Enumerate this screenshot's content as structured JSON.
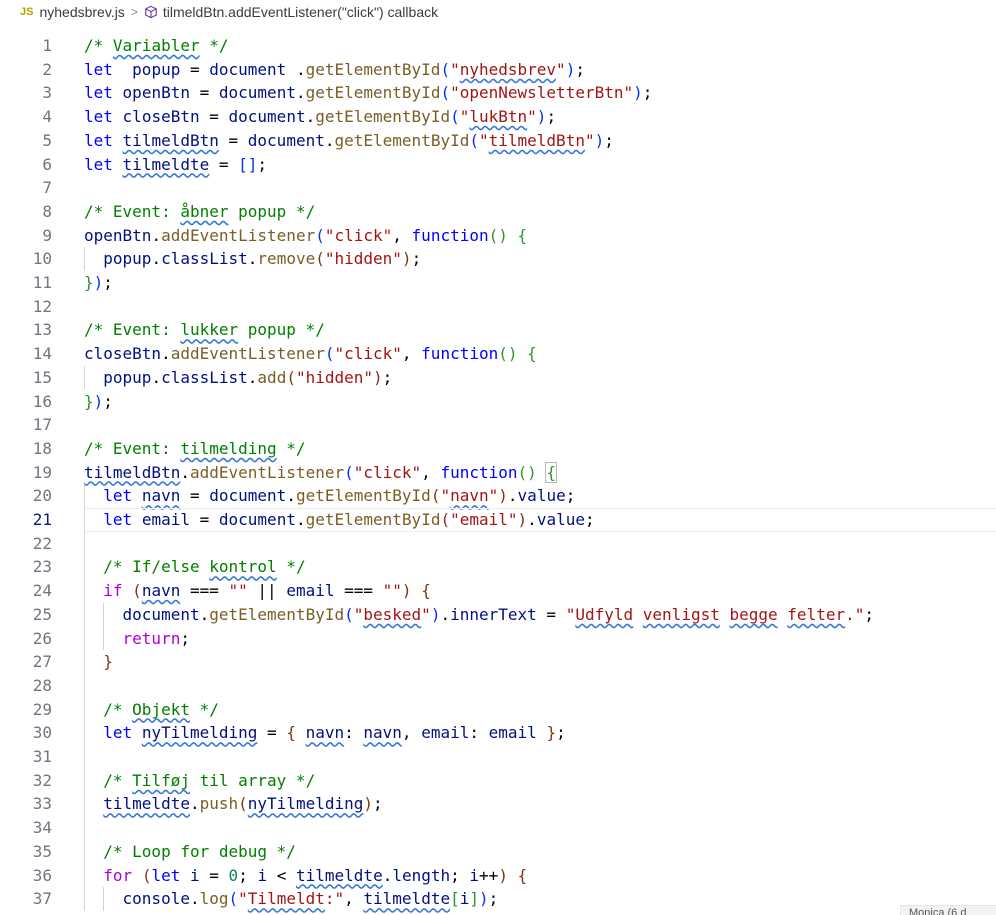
{
  "breadcrumb": {
    "lang_badge": "JS",
    "file": "nyhedsbrev.js",
    "separator": ">",
    "symbol": "tilmeldBtn.addEventListener(\"click\") callback"
  },
  "editor": {
    "current_line": 21,
    "lines": [
      {
        "n": "1",
        "tokens": [
          [
            "cm",
            "/* "
          ],
          [
            "cm sq",
            "Variabler"
          ],
          [
            "cm",
            " */"
          ]
        ]
      },
      {
        "n": "2",
        "tokens": [
          [
            "kw",
            "let"
          ],
          [
            "",
            "  "
          ],
          [
            "var",
            "popup"
          ],
          [
            "",
            " = "
          ],
          [
            "var",
            "document"
          ],
          [
            "",
            " ."
          ],
          [
            "fn",
            "getElementById"
          ],
          [
            "br1",
            "("
          ],
          [
            "str",
            "\""
          ],
          [
            "str sq",
            "nyhedsbrev"
          ],
          [
            "str",
            "\""
          ],
          [
            "br1",
            ")"
          ],
          [
            "",
            ";"
          ]
        ]
      },
      {
        "n": "3",
        "tokens": [
          [
            "kw",
            "let"
          ],
          [
            "",
            " "
          ],
          [
            "var",
            "openBtn"
          ],
          [
            "",
            " = "
          ],
          [
            "var",
            "document"
          ],
          [
            "",
            "."
          ],
          [
            "fn",
            "getElementById"
          ],
          [
            "br1",
            "("
          ],
          [
            "str",
            "\"openNewsletterBtn\""
          ],
          [
            "br1",
            ")"
          ],
          [
            "",
            ";"
          ]
        ]
      },
      {
        "n": "4",
        "tokens": [
          [
            "kw",
            "let"
          ],
          [
            "",
            " "
          ],
          [
            "var",
            "closeBtn"
          ],
          [
            "",
            " = "
          ],
          [
            "var",
            "document"
          ],
          [
            "",
            "."
          ],
          [
            "fn",
            "getElementById"
          ],
          [
            "br1",
            "("
          ],
          [
            "str",
            "\""
          ],
          [
            "str sq",
            "lukBtn"
          ],
          [
            "str",
            "\""
          ],
          [
            "br1",
            ")"
          ],
          [
            "",
            ";"
          ]
        ]
      },
      {
        "n": "5",
        "tokens": [
          [
            "kw",
            "let"
          ],
          [
            "",
            " "
          ],
          [
            "var sq",
            "tilmeldBtn"
          ],
          [
            "",
            " = "
          ],
          [
            "var",
            "document"
          ],
          [
            "",
            "."
          ],
          [
            "fn",
            "getElementById"
          ],
          [
            "br1",
            "("
          ],
          [
            "str",
            "\""
          ],
          [
            "str sq",
            "tilmeldBtn"
          ],
          [
            "str",
            "\""
          ],
          [
            "br1",
            ")"
          ],
          [
            "",
            ";"
          ]
        ]
      },
      {
        "n": "6",
        "tokens": [
          [
            "kw",
            "let"
          ],
          [
            "",
            " "
          ],
          [
            "var sq",
            "tilmeldte"
          ],
          [
            "",
            " = "
          ],
          [
            "br1",
            "[]"
          ],
          [
            "",
            ";"
          ]
        ]
      },
      {
        "n": "7",
        "tokens": []
      },
      {
        "n": "8",
        "tokens": [
          [
            "cm",
            "/* Event: "
          ],
          [
            "cm sq",
            "åbner"
          ],
          [
            "cm",
            " popup */"
          ]
        ]
      },
      {
        "n": "9",
        "tokens": [
          [
            "var",
            "openBtn"
          ],
          [
            "",
            "."
          ],
          [
            "fn",
            "addEventListener"
          ],
          [
            "br1",
            "("
          ],
          [
            "str",
            "\"click\""
          ],
          [
            "",
            ", "
          ],
          [
            "kw",
            "function"
          ],
          [
            "br2",
            "()"
          ],
          [
            "",
            " "
          ],
          [
            "br2",
            "{"
          ]
        ]
      },
      {
        "n": "10",
        "tokens": [
          [
            "",
            "  "
          ],
          [
            "var",
            "popup"
          ],
          [
            "",
            "."
          ],
          [
            "var",
            "classList"
          ],
          [
            "",
            "."
          ],
          [
            "fn",
            "remove"
          ],
          [
            "br3",
            "("
          ],
          [
            "str",
            "\"hidden\""
          ],
          [
            "br3",
            ")"
          ],
          [
            "",
            ";"
          ]
        ]
      },
      {
        "n": "11",
        "tokens": [
          [
            "br2",
            "}"
          ],
          [
            "br1",
            ")"
          ],
          [
            "",
            ";"
          ]
        ]
      },
      {
        "n": "12",
        "tokens": []
      },
      {
        "n": "13",
        "tokens": [
          [
            "cm",
            "/* Event: "
          ],
          [
            "cm sq",
            "lukker"
          ],
          [
            "cm",
            " popup */"
          ]
        ]
      },
      {
        "n": "14",
        "tokens": [
          [
            "var",
            "closeBtn"
          ],
          [
            "",
            "."
          ],
          [
            "fn",
            "addEventListener"
          ],
          [
            "br1",
            "("
          ],
          [
            "str",
            "\"click\""
          ],
          [
            "",
            ", "
          ],
          [
            "kw",
            "function"
          ],
          [
            "br2",
            "()"
          ],
          [
            "",
            " "
          ],
          [
            "br2",
            "{"
          ]
        ]
      },
      {
        "n": "15",
        "tokens": [
          [
            "",
            "  "
          ],
          [
            "var",
            "popup"
          ],
          [
            "",
            "."
          ],
          [
            "var",
            "classList"
          ],
          [
            "",
            "."
          ],
          [
            "fn",
            "add"
          ],
          [
            "br3",
            "("
          ],
          [
            "str",
            "\"hidden\""
          ],
          [
            "br3",
            ")"
          ],
          [
            "",
            ";"
          ]
        ]
      },
      {
        "n": "16",
        "tokens": [
          [
            "br2",
            "}"
          ],
          [
            "br1",
            ")"
          ],
          [
            "",
            ";"
          ]
        ]
      },
      {
        "n": "17",
        "tokens": []
      },
      {
        "n": "18",
        "tokens": [
          [
            "cm",
            "/* Event: "
          ],
          [
            "cm sq",
            "tilmelding"
          ],
          [
            "cm",
            " */"
          ]
        ]
      },
      {
        "n": "19",
        "tokens": [
          [
            "var sq",
            "tilmeldBtn"
          ],
          [
            "",
            "."
          ],
          [
            "fn",
            "addEventListener"
          ],
          [
            "br1",
            "("
          ],
          [
            "str",
            "\"click\""
          ],
          [
            "",
            ", "
          ],
          [
            "kw",
            "function"
          ],
          [
            "br2",
            "()"
          ],
          [
            "",
            " "
          ],
          [
            "br2 bm",
            "{"
          ]
        ]
      },
      {
        "n": "20",
        "tokens": [
          [
            "",
            "  "
          ],
          [
            "kw",
            "let"
          ],
          [
            "",
            " "
          ],
          [
            "var sq",
            "navn"
          ],
          [
            "",
            " = "
          ],
          [
            "var",
            "document"
          ],
          [
            "",
            "."
          ],
          [
            "fn",
            "getElementById"
          ],
          [
            "br3",
            "("
          ],
          [
            "str",
            "\""
          ],
          [
            "str sq",
            "navn"
          ],
          [
            "str",
            "\""
          ],
          [
            "br3",
            ")"
          ],
          [
            "",
            "."
          ],
          [
            "var",
            "value"
          ],
          [
            "",
            ";"
          ]
        ]
      },
      {
        "n": "21",
        "tokens": [
          [
            "",
            "  "
          ],
          [
            "kw",
            "let"
          ],
          [
            "",
            " "
          ],
          [
            "var",
            "email"
          ],
          [
            "",
            " = "
          ],
          [
            "var",
            "document"
          ],
          [
            "",
            "."
          ],
          [
            "fn",
            "getElementById"
          ],
          [
            "br3",
            "("
          ],
          [
            "str",
            "\"email\""
          ],
          [
            "br3",
            ")"
          ],
          [
            "",
            "."
          ],
          [
            "var",
            "value"
          ],
          [
            "",
            ";"
          ]
        ]
      },
      {
        "n": "22",
        "tokens": []
      },
      {
        "n": "23",
        "tokens": [
          [
            "",
            "  "
          ],
          [
            "cm",
            "/* If/else "
          ],
          [
            "cm sq",
            "kontrol"
          ],
          [
            "cm",
            " */"
          ]
        ]
      },
      {
        "n": "24",
        "tokens": [
          [
            "",
            "  "
          ],
          [
            "ctl",
            "if"
          ],
          [
            "",
            " "
          ],
          [
            "br3",
            "("
          ],
          [
            "var sq",
            "navn"
          ],
          [
            "",
            " === "
          ],
          [
            "str",
            "\"\""
          ],
          [
            "",
            " || "
          ],
          [
            "var",
            "email"
          ],
          [
            "",
            " === "
          ],
          [
            "str",
            "\"\""
          ],
          [
            "br3",
            ")"
          ],
          [
            "",
            " "
          ],
          [
            "br3",
            "{"
          ]
        ]
      },
      {
        "n": "25",
        "tokens": [
          [
            "",
            "    "
          ],
          [
            "var",
            "document"
          ],
          [
            "",
            "."
          ],
          [
            "fn",
            "getElementById"
          ],
          [
            "br1",
            "("
          ],
          [
            "str",
            "\""
          ],
          [
            "str sq",
            "besked"
          ],
          [
            "str",
            "\""
          ],
          [
            "br1",
            ")"
          ],
          [
            "",
            "."
          ],
          [
            "var",
            "innerText"
          ],
          [
            "",
            " = "
          ],
          [
            "str",
            "\""
          ],
          [
            "str sq",
            "Udfyld"
          ],
          [
            "str",
            " "
          ],
          [
            "str sq",
            "venligst"
          ],
          [
            "str",
            " "
          ],
          [
            "str sq",
            "begge"
          ],
          [
            "str",
            " "
          ],
          [
            "str sq",
            "felter"
          ],
          [
            "str",
            ".\""
          ],
          [
            "",
            ";"
          ]
        ]
      },
      {
        "n": "26",
        "tokens": [
          [
            "",
            "    "
          ],
          [
            "ctl",
            "return"
          ],
          [
            "",
            ";"
          ]
        ]
      },
      {
        "n": "27",
        "tokens": [
          [
            "",
            "  "
          ],
          [
            "br3",
            "}"
          ]
        ]
      },
      {
        "n": "28",
        "tokens": []
      },
      {
        "n": "29",
        "tokens": [
          [
            "",
            "  "
          ],
          [
            "cm",
            "/* "
          ],
          [
            "cm sq",
            "Objekt"
          ],
          [
            "cm",
            " */"
          ]
        ]
      },
      {
        "n": "30",
        "tokens": [
          [
            "",
            "  "
          ],
          [
            "kw",
            "let"
          ],
          [
            "",
            " "
          ],
          [
            "var sq",
            "nyTilmelding"
          ],
          [
            "",
            " = "
          ],
          [
            "br3",
            "{"
          ],
          [
            "",
            " "
          ],
          [
            "var sq",
            "navn"
          ],
          [
            "",
            ": "
          ],
          [
            "var sq",
            "navn"
          ],
          [
            "",
            ", "
          ],
          [
            "var",
            "email"
          ],
          [
            "",
            ": "
          ],
          [
            "var",
            "email"
          ],
          [
            "",
            " "
          ],
          [
            "br3",
            "}"
          ],
          [
            "",
            ";"
          ]
        ]
      },
      {
        "n": "31",
        "tokens": []
      },
      {
        "n": "32",
        "tokens": [
          [
            "",
            "  "
          ],
          [
            "cm",
            "/* "
          ],
          [
            "cm sq",
            "Tilføj"
          ],
          [
            "cm",
            " til array */"
          ]
        ]
      },
      {
        "n": "33",
        "tokens": [
          [
            "",
            "  "
          ],
          [
            "var sq",
            "tilmeldte"
          ],
          [
            "",
            "."
          ],
          [
            "fn",
            "push"
          ],
          [
            "br3",
            "("
          ],
          [
            "var sq",
            "nyTilmelding"
          ],
          [
            "br3",
            ")"
          ],
          [
            "",
            ";"
          ]
        ]
      },
      {
        "n": "34",
        "tokens": []
      },
      {
        "n": "35",
        "tokens": [
          [
            "",
            "  "
          ],
          [
            "cm",
            "/* Loop for debug */"
          ]
        ]
      },
      {
        "n": "36",
        "tokens": [
          [
            "",
            "  "
          ],
          [
            "ctl",
            "for"
          ],
          [
            "",
            " "
          ],
          [
            "br3",
            "("
          ],
          [
            "kw",
            "let"
          ],
          [
            "",
            " "
          ],
          [
            "var",
            "i"
          ],
          [
            "",
            " = "
          ],
          [
            "num",
            "0"
          ],
          [
            "",
            "; "
          ],
          [
            "var",
            "i"
          ],
          [
            "",
            " < "
          ],
          [
            "var sq",
            "tilmeldte"
          ],
          [
            "",
            "."
          ],
          [
            "var",
            "length"
          ],
          [
            "",
            "; "
          ],
          [
            "var",
            "i"
          ],
          [
            "",
            "++"
          ],
          [
            "br3",
            ")"
          ],
          [
            "",
            " "
          ],
          [
            "br3",
            "{"
          ]
        ]
      },
      {
        "n": "37",
        "tokens": [
          [
            "",
            "    "
          ],
          [
            "var",
            "console"
          ],
          [
            "",
            "."
          ],
          [
            "fn",
            "log"
          ],
          [
            "br1",
            "("
          ],
          [
            "str",
            "\""
          ],
          [
            "str sq",
            "Tilmeldt"
          ],
          [
            "str",
            ":\""
          ],
          [
            "",
            ", "
          ],
          [
            "var sq",
            "tilmeldte"
          ],
          [
            "br2",
            "["
          ],
          [
            "var",
            "i"
          ],
          [
            "br2",
            "]"
          ],
          [
            "br1",
            ")"
          ],
          [
            "",
            ";"
          ]
        ]
      }
    ]
  },
  "status_corner": {
    "text": "Monica (6 d"
  }
}
